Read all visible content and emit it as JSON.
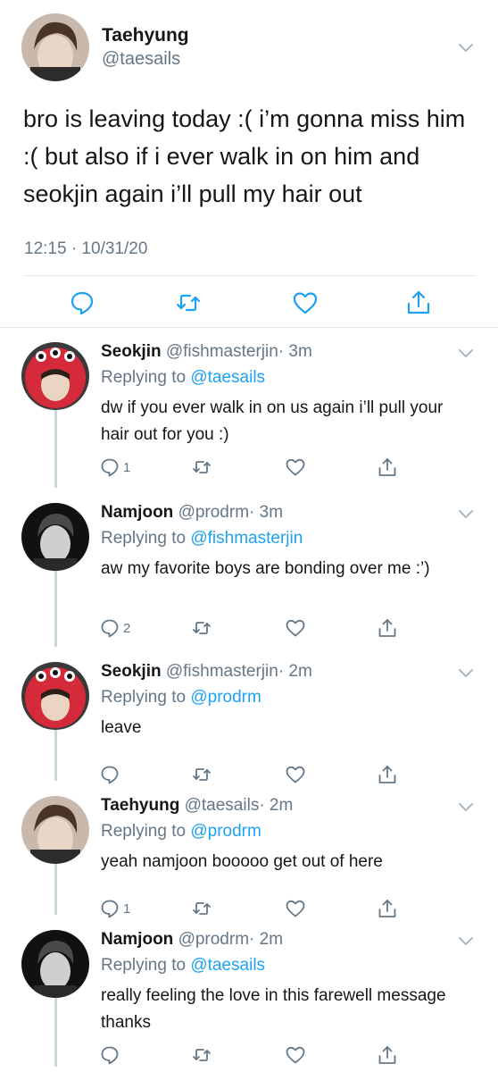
{
  "main_tweet": {
    "name": "Taehyung",
    "handle": "@taesails",
    "text": "bro is leaving today :( i’m gonna miss him :( but also if i ever walk in on him and seokjin again i’ll pull my hair out",
    "timestamp": "12:15 · 10/31/20"
  },
  "replies": [
    {
      "name": "Seokjin",
      "handle": "@fishmasterjin",
      "time": "· 3m",
      "replying_prefix": "Replying to ",
      "replying_to": "@taesails",
      "text": "dw if you ever walk in on us again i’ll pull your hair out for you :)",
      "reply_count": "1",
      "avatar": "red-hood"
    },
    {
      "name": "Namjoon",
      "handle": "@prodrm",
      "time": "· 3m",
      "replying_prefix": "Replying to ",
      "replying_to": "@fishmasterjin",
      "text": "aw my favorite boys are bonding over me :’)",
      "reply_count": "2",
      "avatar": "mono"
    },
    {
      "name": "Seokjin",
      "handle": "@fishmasterjin",
      "time": "· 2m",
      "replying_prefix": "Replying to ",
      "replying_to": "@prodrm",
      "text": "leave",
      "reply_count": "",
      "avatar": "red-hood"
    },
    {
      "name": "Taehyung",
      "handle": "@taesails",
      "time": "· 2m",
      "replying_prefix": "Replying to ",
      "replying_to": "@prodrm",
      "text": "yeah namjoon booooo get out of here",
      "reply_count": "1",
      "avatar": "brown"
    },
    {
      "name": "Namjoon",
      "handle": "@prodrm",
      "time": "· 2m",
      "replying_prefix": "Replying to ",
      "replying_to": "@taesails",
      "text": "really feeling the love in this farewell message thanks",
      "reply_count": "",
      "avatar": "mono"
    }
  ],
  "colors": {
    "link": "#1da1f2",
    "secondary_text": "#657786",
    "divider": "#e1e8ed",
    "thread_line": "#ccd6dd"
  },
  "icons": [
    "chevron-down-icon",
    "reply-icon",
    "retweet-icon",
    "like-icon",
    "share-icon"
  ]
}
